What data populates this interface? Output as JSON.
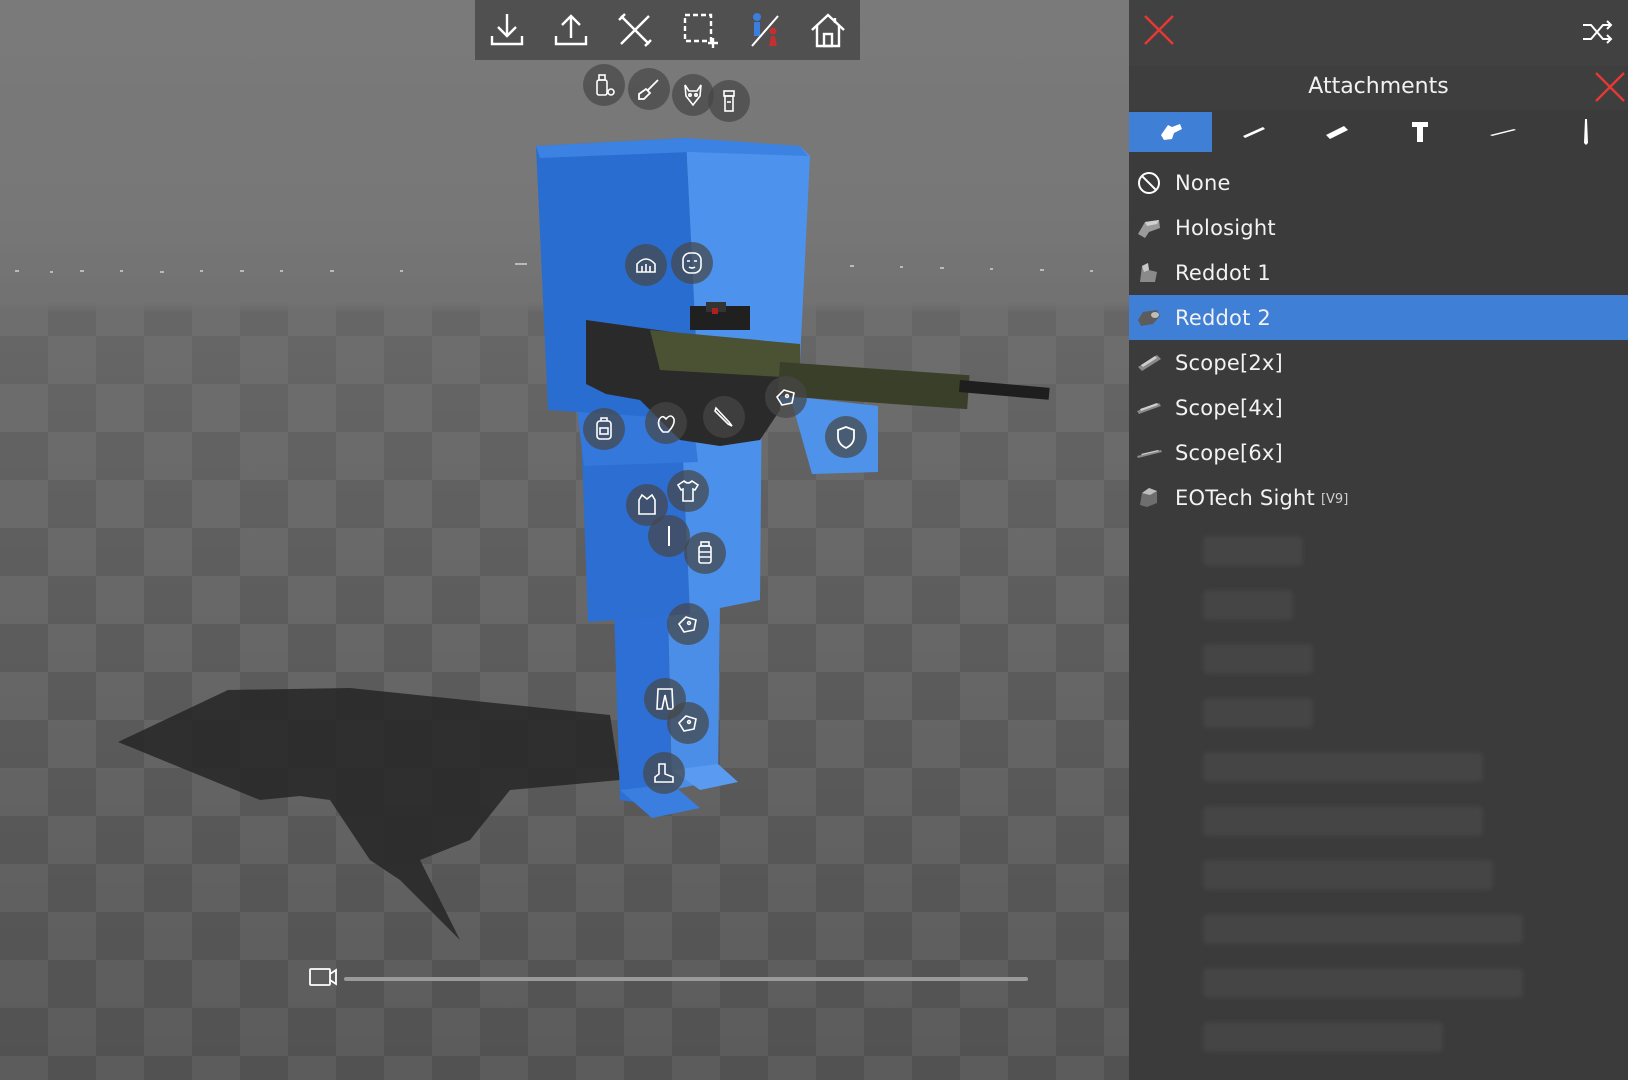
{
  "app": {
    "toolbar": {
      "tools": [
        {
          "id": "import",
          "icon": "download-icon"
        },
        {
          "id": "export",
          "icon": "upload-icon"
        },
        {
          "id": "tools",
          "icon": "crossed-tools-icon"
        },
        {
          "id": "select",
          "icon": "crop-select-icon"
        },
        {
          "id": "gender",
          "icon": "gender-swap-icon"
        },
        {
          "id": "home",
          "icon": "home-icon"
        }
      ]
    },
    "panel": {
      "title": "Attachments",
      "close_icon": "close-icon",
      "shuffle_icon": "shuffle-icon",
      "accent_color": "#3f7fd6",
      "close_color": "#e53935",
      "tabs": [
        {
          "icon": "sight-attachment-icon",
          "active": true
        },
        {
          "icon": "barrel-attachment-icon",
          "active": false
        },
        {
          "icon": "muzzle-attachment-icon",
          "active": false
        },
        {
          "icon": "grip-attachment-icon",
          "active": false
        },
        {
          "icon": "rail-attachment-icon",
          "active": false
        },
        {
          "icon": "bayonet-attachment-icon",
          "active": false
        }
      ],
      "items": [
        {
          "label": "None",
          "icon": "none-icon",
          "selected": false,
          "tag": ""
        },
        {
          "label": "Holosight",
          "icon": "holosight-icon",
          "selected": false,
          "tag": ""
        },
        {
          "label": "Reddot 1",
          "icon": "reddot-icon",
          "selected": false,
          "tag": ""
        },
        {
          "label": "Reddot 2",
          "icon": "reddot-icon",
          "selected": true,
          "tag": ""
        },
        {
          "label": "Scope[2x]",
          "icon": "scope-icon",
          "selected": false,
          "tag": ""
        },
        {
          "label": "Scope[4x]",
          "icon": "scope-icon",
          "selected": false,
          "tag": ""
        },
        {
          "label": "Scope[6x]",
          "icon": "scope-icon",
          "selected": false,
          "tag": ""
        },
        {
          "label": "EOTech Sight",
          "icon": "eotech-icon",
          "selected": false,
          "tag": "[V9]"
        }
      ]
    },
    "hotspots": [
      {
        "name": "hotspot-accessory-left",
        "icon": "bottle-gear-icon"
      },
      {
        "name": "hotspot-paint",
        "icon": "paint-brush-icon"
      },
      {
        "name": "hotspot-mask",
        "icon": "animal-mask-icon"
      },
      {
        "name": "hotspot-flashlight",
        "icon": "flashlight-icon"
      },
      {
        "name": "hotspot-helmet",
        "icon": "helmet-icon"
      },
      {
        "name": "hotspot-face",
        "icon": "face-icon"
      },
      {
        "name": "hotspot-backpack",
        "icon": "backpack-icon"
      },
      {
        "name": "hotspot-gloves",
        "icon": "glove-icon"
      },
      {
        "name": "hotspot-knife",
        "icon": "knife-icon"
      },
      {
        "name": "hotspot-tag",
        "icon": "tag-icon"
      },
      {
        "name": "hotspot-shield",
        "icon": "shield-icon"
      },
      {
        "name": "hotspot-vest",
        "icon": "vest-icon"
      },
      {
        "name": "hotspot-shirt",
        "icon": "shirt-icon"
      },
      {
        "name": "hotspot-baton",
        "icon": "baton-icon"
      },
      {
        "name": "hotspot-canister",
        "icon": "canister-icon"
      },
      {
        "name": "hotspot-leg-tag",
        "icon": "tag-icon"
      },
      {
        "name": "hotspot-pants",
        "icon": "pants-icon"
      },
      {
        "name": "hotspot-leg-tag-2",
        "icon": "tag-icon"
      },
      {
        "name": "hotspot-boots",
        "icon": "boot-icon"
      }
    ],
    "timeline": {
      "thumb_icon": "camera-icon"
    }
  }
}
